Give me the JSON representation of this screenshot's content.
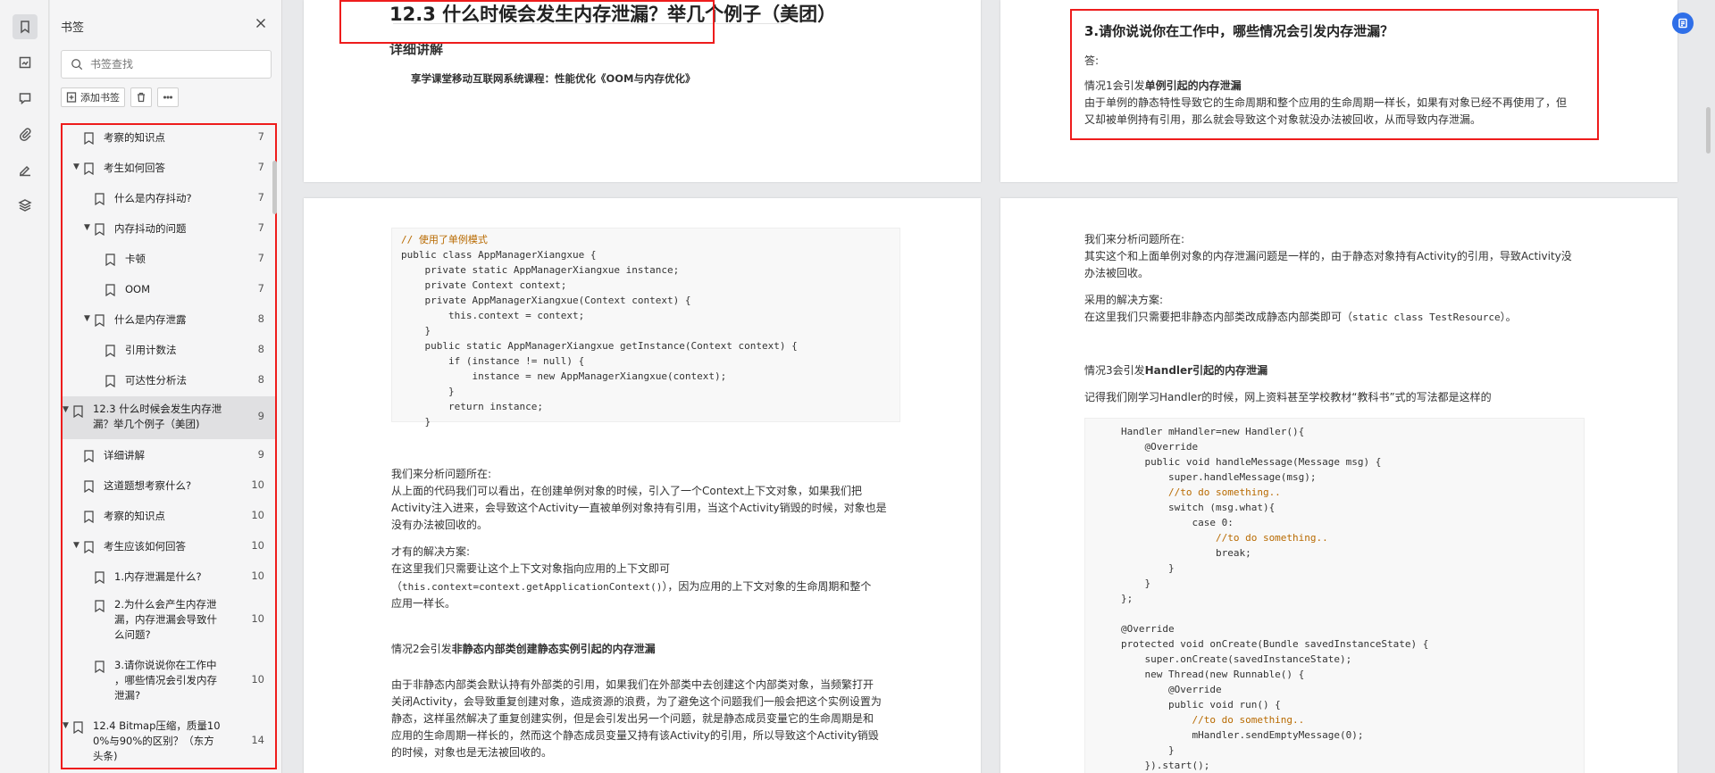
{
  "panel": {
    "title": "书签",
    "search_placeholder": "书签查找",
    "add_bookmark_label": "添加书签",
    "items": [
      {
        "label": "考察的知识点",
        "page": "7"
      },
      {
        "label": "考生如何回答",
        "page": "7"
      },
      {
        "label": "什么是内存抖动?",
        "page": "7"
      },
      {
        "label": "内存抖动的问题",
        "page": "7"
      },
      {
        "label": "卡顿",
        "page": "7"
      },
      {
        "label": "OOM",
        "page": "7"
      },
      {
        "label": "什么是内存泄露",
        "page": "8"
      },
      {
        "label": "引用计数法",
        "page": "8"
      },
      {
        "label": "可达性分析法",
        "page": "8"
      },
      {
        "label_l1": "12.3 什么时候会发生内存泄",
        "label_l2": "漏？举几个例子（美团)",
        "page": "9"
      },
      {
        "label": "详细讲解",
        "page": "9"
      },
      {
        "label": "这道题想考察什么?",
        "page": "10"
      },
      {
        "label": "考察的知识点",
        "page": "10"
      },
      {
        "label": "考生应该如何回答",
        "page": "10"
      },
      {
        "label": "1.内存泄漏是什么?",
        "page": "10"
      },
      {
        "label_l1": "2.为什么会产生内存泄",
        "label_l2": "漏，内存泄漏会导致什",
        "label_l3": "么问题?",
        "page": "10"
      },
      {
        "label_l1": "3.请你说说你在工作中",
        "label_l2": "，哪些情况会引发内存",
        "label_l3": "泄漏?",
        "page": "10"
      },
      {
        "label_l1": "12.4 Bitmap压缩，质量10",
        "label_l2": "0%与90%的区别？（东方",
        "label_l3": "头条)",
        "page": "14"
      }
    ]
  },
  "page1": {
    "heading": "12.3 什么时候会发生内存泄漏？举几个例子（美团）",
    "subheading": "详细讲解",
    "course": "享学课堂移动互联网系统课程：性能优化《OOM与内存优化》"
  },
  "page2": {
    "heading": "3.请你说说你在工作中，哪些情况会引发内存泄漏？",
    "answer": "答:",
    "case1_prefix": "情况1会引发",
    "case1_bold": "单例引起的内存泄漏",
    "case1_l1": "由于单例的静态特性导致它的生命周期和整个应用的生命周期一样长，如果有对象已经不再使用了，但",
    "case1_l2": "又却被单例持有引用，那么就会导致这个对象就没办法被回收，从而导致内存泄漏。"
  },
  "page3": {
    "code_comment": "// 使用了单例模式",
    "code": [
      "public class AppManagerXiangxue {",
      "    private static AppManagerXiangxue instance;",
      "    private Context context;",
      "    private AppManagerXiangxue(Context context) {",
      "        this.context = context;",
      "    }",
      "    public static AppManagerXiangxue getInstance(Context context) {",
      "        if (instance != null) {",
      "            instance = new AppManagerXiangxue(context);",
      "        }",
      "        return instance;",
      "    }",
      "}"
    ],
    "analysis_title": "我们来分析问题所在:",
    "analysis_l1": " 从上面的代码我们可以看出，在创建单例对象的时候，引入了一个Context上下文对象，如果我们把",
    "analysis_l2": "Activity注入进来，会导致这个Activity一直被单例对象持有引用，当这个Activity销毁的时候，对象也是",
    "analysis_l3": "没有办法被回收的。",
    "solution_title": "才有的解决方案:",
    "solution_l1": " 在这里我们只需要让这个上下文对象指向应用的上下文即可",
    "solution_code": "this.context=context.getApplicationContext()",
    "solution_l2_pre": " （",
    "solution_l2_post": "），因为应用的上下文对象的生命周期和整个",
    "solution_l3": "应用一样长。",
    "case2_prefix": "情况2会引发",
    "case2_bold": "非静态内部类创建静态实例引起的内存泄漏",
    "case2_l1": "由于非静态内部类会默认持有外部类的引用，如果我们在外部类中去创建这个内部类对象，当频繁打开",
    "case2_l2": "关闭Activity，会导致重复创建对象，造成资源的浪费，为了避免这个问题我们一般会把这个实例设置为",
    "case2_l3": "静态，这样虽然解决了重复创建实例，但是会引发出另一个问题，就是静态成员变量它的生命周期是和",
    "case2_l4": "应用的生命周期一样长的，然而这个静态成员变量又持有该Activity的引用，所以导致这个Activity销毁",
    "case2_l5": "的时候，对象也是无法被回收的。"
  },
  "page4": {
    "analysis_title": "我们来分析问题所在:",
    "analysis_l1": "其实这个和上面单例对象的内存泄漏问题是一样的，由于静态对象持有Activity的引用，导致Activity没",
    "analysis_l2": "办法被回收。",
    "solution_title": "采用的解决方案:",
    "solution_l1_pre": "在这里我们只需要把非静态内部类改成静态内部类即可（",
    "solution_code": "static class TestResource",
    "solution_l1_post": "）。",
    "case3_prefix": "情况3会引发",
    "case3_bold": "Handler引起的内存泄漏",
    "intro": "记得我们刚学习Handler的时候，网上资料甚至学校教材“教科书”式的写法都是这样的",
    "code": [
      "Handler mHandler=new Handler(){",
      "    @Override",
      "    public void handleMessage(Message msg) {",
      "        super.handleMessage(msg);",
      "        //to do something..",
      "        switch (msg.what){",
      "            case 0:",
      "                //to do something..",
      "                break;",
      "        }",
      "    }",
      "};",
      "",
      "@Override",
      "protected void onCreate(Bundle savedInstanceState) {",
      "    super.onCreate(savedInstanceState);",
      "    new Thread(new Runnable() {",
      "        @Override",
      "        public void run() {",
      "            //to do something..",
      "            mHandler.sendEmptyMessage(0);",
      "        }",
      "    }).start();"
    ]
  }
}
